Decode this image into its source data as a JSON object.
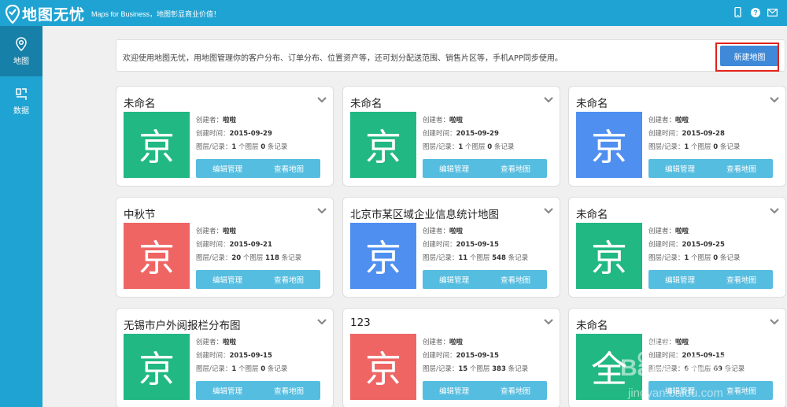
{
  "app": {
    "title": "地图无忧",
    "tagline": "Maps for Business，地图彰显商业价值！"
  },
  "top_icons": [
    "mobile-icon",
    "help-icon",
    "mail-icon"
  ],
  "sidebar": {
    "items": [
      {
        "label": "地图",
        "icon": "map-pin-icon",
        "active": true
      },
      {
        "label": "数据",
        "icon": "data-icon",
        "active": false
      }
    ]
  },
  "welcome": {
    "text": "欢迎使用地图无忧，用地图管理你的客户分布、订单分布、位置资产等，还可划分配送范围、销售片区等，手机APP同步使用。",
    "new_map_label": "新建地图"
  },
  "labels": {
    "creator": "创建者：",
    "created": "创建时间：",
    "layers": "图层/记录：",
    "layers_unit": "个图层",
    "records_unit": "条记录",
    "edit": "编辑管理",
    "view": "查看地图"
  },
  "colors": {
    "brand": "#1fa3d2",
    "green": "#21b883",
    "blue": "#4f8ff0",
    "red": "#ee6564",
    "button": "#55bde0",
    "primary_button": "#3e8ad9",
    "highlight": "#e2231a"
  },
  "maps": [
    {
      "title": "未命名",
      "thumb_char": "京",
      "color": "#21b883",
      "creator": "啦啦",
      "date": "2015-09-29",
      "layers": "1",
      "records": "0"
    },
    {
      "title": "未命名",
      "thumb_char": "京",
      "color": "#21b883",
      "creator": "啦啦",
      "date": "2015-09-29",
      "layers": "1",
      "records": "0"
    },
    {
      "title": "未命名",
      "thumb_char": "京",
      "color": "#4f8ff0",
      "creator": "啦啦",
      "date": "2015-09-28",
      "layers": "1",
      "records": "0"
    },
    {
      "title": "中秋节",
      "thumb_char": "京",
      "color": "#ee6564",
      "creator": "啦啦",
      "date": "2015-09-21",
      "layers": "20",
      "records": "118"
    },
    {
      "title": "北京市某区域企业信息统计地图",
      "thumb_char": "京",
      "color": "#4f8ff0",
      "creator": "啦啦",
      "date": "2015-09-15",
      "layers": "11",
      "records": "548"
    },
    {
      "title": "未命名",
      "thumb_char": "京",
      "color": "#21b883",
      "creator": "啦啦",
      "date": "2015-09-25",
      "layers": "1",
      "records": "0"
    },
    {
      "title": "无锡市户外阅报栏分布图",
      "thumb_char": "京",
      "color": "#21b883",
      "creator": "啦啦",
      "date": "2015-09-15",
      "layers": "1",
      "records": "0"
    },
    {
      "title": "123",
      "thumb_char": "京",
      "color": "#ee6564",
      "creator": "啦啦",
      "date": "2015-09-15",
      "layers": "15",
      "records": "383"
    },
    {
      "title": "未命名",
      "thumb_char": "全",
      "color": "#21b883",
      "creator": "啦啦",
      "date": "2015-09-15",
      "layers": "6",
      "records": "69"
    }
  ],
  "watermark": {
    "brand": "Bai 经验",
    "url": "jingyan.baidu.com"
  }
}
